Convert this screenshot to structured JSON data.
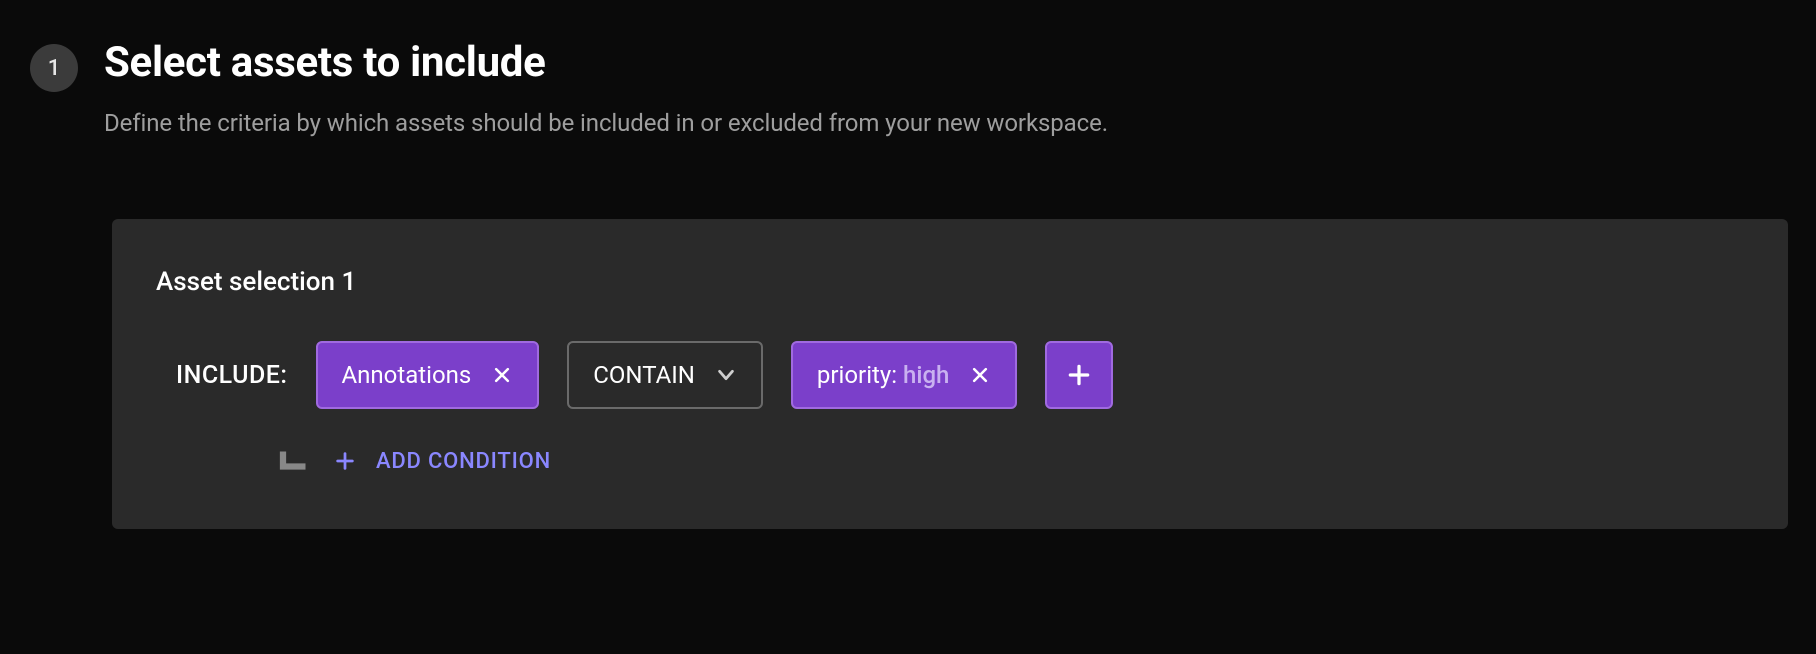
{
  "step": {
    "number": "1"
  },
  "header": {
    "title": "Select assets to include",
    "subtitle": "Define the criteria by which assets should be included in or excluded from your new workspace."
  },
  "panel": {
    "title": "Asset selection 1",
    "rule": {
      "mode_label": "INCLUDE:",
      "subject": "Annotations",
      "operator": "CONTAIN",
      "value_key": "priority:",
      "value_val": "high"
    },
    "add_condition_label": "ADD CONDITION"
  }
}
